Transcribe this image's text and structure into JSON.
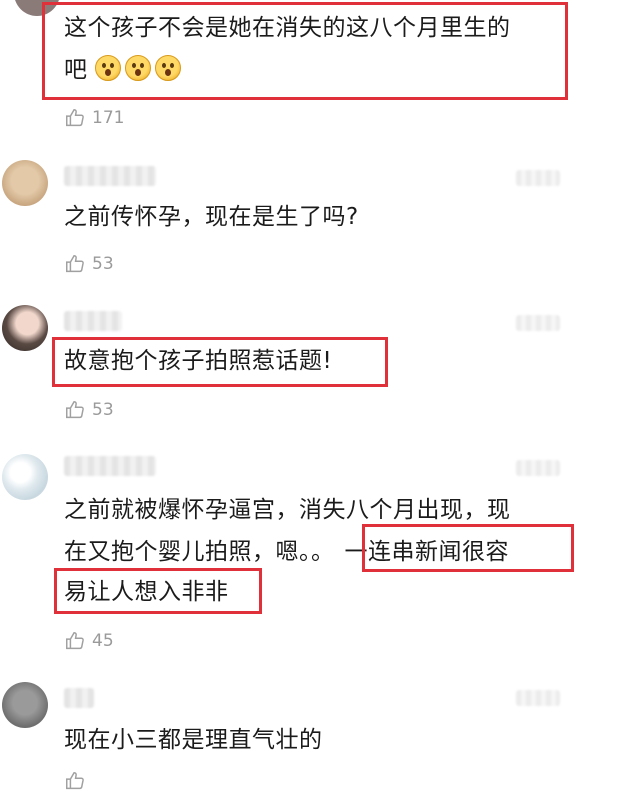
{
  "comments": [
    {
      "text_lines": [
        "这个孩子不会是她在消失的这八个月里生的",
        "吧"
      ],
      "emoji": [
        "hushed-face-emoji",
        "hushed-face-emoji",
        "hushed-face-emoji"
      ],
      "likes": "171"
    },
    {
      "text_lines": [
        "之前传怀孕，现在是生了吗?"
      ],
      "likes": "53"
    },
    {
      "text_lines": [
        "故意抱个孩子拍照惹话题!"
      ],
      "likes": "53"
    },
    {
      "text_lines": [
        "之前就被爆怀孕逼宫，消失八个月出现，现",
        "在又抱个婴儿拍照，嗯。。",
        "一连串新闻很容",
        "易让人想入非非"
      ],
      "likes": "45"
    },
    {
      "text_lines": [
        "现在小三都是理直气壮的"
      ]
    }
  ],
  "colors": {
    "highlight_box": "#e0313a",
    "meta_gray": "#9a9a9a"
  }
}
